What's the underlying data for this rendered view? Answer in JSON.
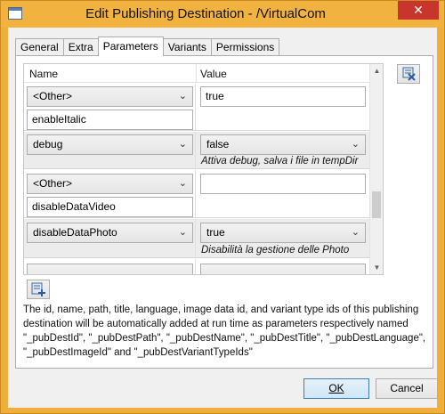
{
  "window": {
    "title": "Edit Publishing Destination - /VirtualCom",
    "close_glyph": "✕"
  },
  "tabs": [
    {
      "label": "General",
      "active": false
    },
    {
      "label": "Extra",
      "active": false
    },
    {
      "label": "Parameters",
      "active": true
    },
    {
      "label": "Variants",
      "active": false
    },
    {
      "label": "Permissions",
      "active": false
    }
  ],
  "grid": {
    "columns": {
      "name": "Name",
      "value": "Value"
    },
    "rows": [
      {
        "name_select": "<Other>",
        "name_text": "enableItalic",
        "value_text": "true",
        "description": ""
      },
      {
        "name_select": "debug",
        "name_text": "",
        "value_select": "false",
        "description": "Attiva debug, salva i file in tempDir"
      },
      {
        "name_select": "<Other>",
        "name_text": "disableDataVideo",
        "value_text": "",
        "description": ""
      },
      {
        "name_select": "disableDataPhoto",
        "name_text": "",
        "value_select": "true",
        "description": "Disabilità la gestione delle Photo"
      }
    ]
  },
  "info_text": "The id, name, path, title, language, image data id, and variant type ids of this publishing destination will be automatically added at run time as parameters respectively named \"_pubDestId\", \"_pubDestPath\", \"_pubDestName\", \"_pubDestTitle\", \"_pubDestLanguage\", \"_pubDestImageId\" and \"_pubDestVariantTypeIds\"",
  "buttons": {
    "ok": "OK",
    "cancel": "Cancel"
  },
  "icons": {
    "remove": "remove-parameter-icon",
    "add": "add-parameter-icon"
  },
  "colors": {
    "titlebar": "#f2b23f",
    "close": "#c7352d",
    "default_button": "#3c7fb1"
  }
}
